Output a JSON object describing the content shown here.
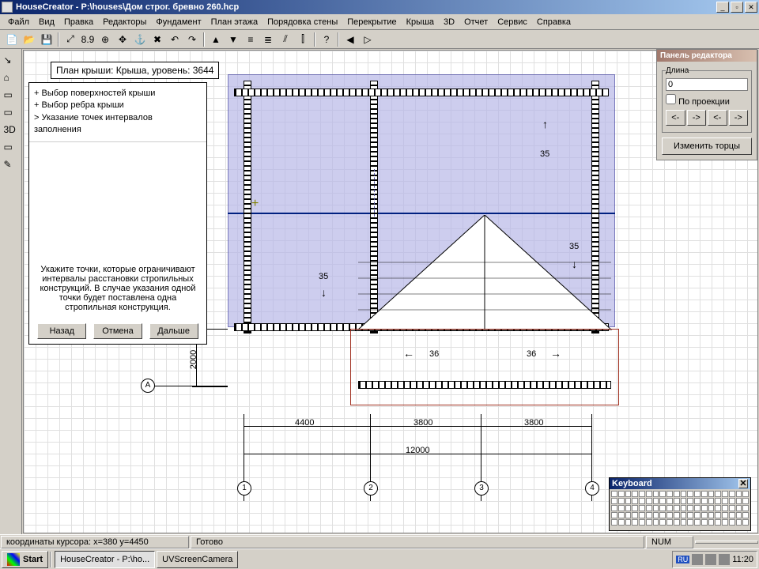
{
  "app": {
    "title": "HouseCreator - P:\\houses\\Дом строг. бревно 260.hcp"
  },
  "menu": [
    "Файл",
    "Вид",
    "Правка",
    "Редакторы",
    "Фундамент",
    "План этажа",
    "Порядовка стены",
    "Перекрытие",
    "Крыша",
    "3D",
    "Отчет",
    "Сервис",
    "Справка"
  ],
  "toolbar_icons": [
    "📄",
    "📂",
    "💾",
    "|",
    "⤢",
    "8.9",
    "⊕",
    "✥",
    "⚓",
    "✖",
    "↶",
    "↷",
    "|",
    "▲",
    "▼",
    "≡",
    "≣",
    "⫽",
    "⫿",
    "|",
    "?",
    "|",
    "◀",
    "▷"
  ],
  "left_icons": [
    "↘",
    "⌂",
    "▭",
    "▭",
    "3D",
    "▭",
    "✎"
  ],
  "wizard": {
    "title": "План крыши: Крыша, уровень: 3644",
    "steps": [
      "+ Выбор поверхностей крыши",
      "+ Выбор ребра крыши",
      "> Указание точек интервалов заполнения"
    ],
    "hint": "Укажите точки, которые ограничивают интервалы расстановки стропильных конструкций. В случае указания одной точки будет поставлена одна стропильная конструкция.",
    "back": "Назад",
    "cancel": "Отмена",
    "next": "Дальше"
  },
  "editor": {
    "panel_title": "Панель редактора",
    "length_label": "Длина",
    "length_value": "0",
    "projection_label": "По проекции",
    "arrows": [
      "<-",
      "->",
      "<-",
      "->"
    ],
    "change": "Изменить торцы"
  },
  "drawing": {
    "labels35": [
      "35",
      "35",
      "35"
    ],
    "labels36": [
      "36",
      "36"
    ],
    "dims": [
      "4400",
      "3800",
      "3800",
      "12000",
      "2000"
    ],
    "axes": [
      "А",
      "1",
      "2",
      "3",
      "4"
    ]
  },
  "keyboard": {
    "title": "Keyboard"
  },
  "status": {
    "coords": "координаты курсора: x=380 y=4450",
    "ready": "Готово",
    "num": "NUM"
  },
  "taskbar": {
    "start": "Start",
    "tasks": [
      "HouseCreator - P:\\ho...",
      "UVScreenCamera"
    ],
    "lang": "RU",
    "clock": "11:20"
  }
}
